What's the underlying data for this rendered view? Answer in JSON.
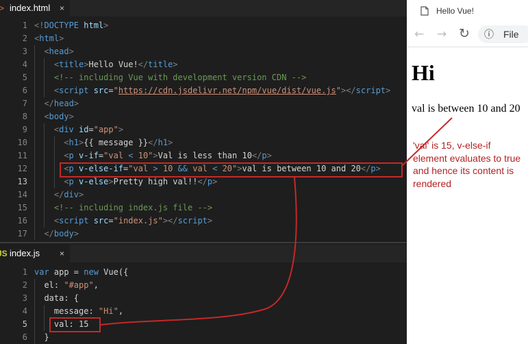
{
  "editor_top": {
    "tab": {
      "file_type": "<>",
      "name": "index.html",
      "close": "×"
    },
    "lines": [
      {
        "n": "1",
        "indent": 0,
        "tokens": [
          [
            "t-punc",
            "<!"
          ],
          [
            "t-tag",
            "DOCTYPE"
          ],
          [
            "t-txt",
            " "
          ],
          [
            "t-attr",
            "html"
          ],
          [
            "t-punc",
            ">"
          ]
        ]
      },
      {
        "n": "2",
        "indent": 0,
        "tokens": [
          [
            "t-punc",
            "<"
          ],
          [
            "t-tag",
            "html"
          ],
          [
            "t-punc",
            ">"
          ]
        ]
      },
      {
        "n": "3",
        "indent": 1,
        "tokens": [
          [
            "t-punc",
            "<"
          ],
          [
            "t-tag",
            "head"
          ],
          [
            "t-punc",
            ">"
          ]
        ]
      },
      {
        "n": "4",
        "indent": 2,
        "tokens": [
          [
            "t-punc",
            "<"
          ],
          [
            "t-tag",
            "title"
          ],
          [
            "t-punc",
            ">"
          ],
          [
            "t-txt",
            "Hello Vue!"
          ],
          [
            "t-punc",
            "</"
          ],
          [
            "t-tag",
            "title"
          ],
          [
            "t-punc",
            ">"
          ]
        ]
      },
      {
        "n": "5",
        "indent": 2,
        "tokens": [
          [
            "t-com",
            "<!-- including Vue with development version CDN -->"
          ]
        ]
      },
      {
        "n": "6",
        "indent": 2,
        "tokens": [
          [
            "t-punc",
            "<"
          ],
          [
            "t-tag",
            "script"
          ],
          [
            "t-txt",
            " "
          ],
          [
            "t-attr",
            "src"
          ],
          [
            "t-txt",
            "="
          ],
          [
            "t-str",
            "\""
          ],
          [
            "t-url",
            "https://cdn.jsdelivr.net/npm/vue/dist/vue.js"
          ],
          [
            "t-str",
            "\""
          ],
          [
            "t-punc",
            "></"
          ],
          [
            "t-tag",
            "script"
          ],
          [
            "t-punc",
            ">"
          ]
        ]
      },
      {
        "n": "7",
        "indent": 1,
        "tokens": [
          [
            "t-punc",
            "</"
          ],
          [
            "t-tag",
            "head"
          ],
          [
            "t-punc",
            ">"
          ]
        ]
      },
      {
        "n": "8",
        "indent": 1,
        "tokens": [
          [
            "t-punc",
            "<"
          ],
          [
            "t-tag",
            "body"
          ],
          [
            "t-punc",
            ">"
          ]
        ]
      },
      {
        "n": "9",
        "indent": 2,
        "tokens": [
          [
            "t-punc",
            "<"
          ],
          [
            "t-tag",
            "div"
          ],
          [
            "t-txt",
            " "
          ],
          [
            "t-attr",
            "id"
          ],
          [
            "t-txt",
            "="
          ],
          [
            "t-str",
            "\"app\""
          ],
          [
            "t-punc",
            ">"
          ]
        ]
      },
      {
        "n": "10",
        "indent": 3,
        "tokens": [
          [
            "t-punc",
            "<"
          ],
          [
            "t-tag",
            "h1"
          ],
          [
            "t-punc",
            ">"
          ],
          [
            "t-txt",
            "{{ message }}"
          ],
          [
            "t-punc",
            "</"
          ],
          [
            "t-tag",
            "h1"
          ],
          [
            "t-punc",
            ">"
          ]
        ]
      },
      {
        "n": "11",
        "indent": 3,
        "tokens": [
          [
            "t-punc",
            "<"
          ],
          [
            "t-tag",
            "p"
          ],
          [
            "t-txt",
            " "
          ],
          [
            "t-attr",
            "v-if"
          ],
          [
            "t-txt",
            "="
          ],
          [
            "t-str",
            "\"val "
          ],
          [
            "t-tag",
            "<"
          ],
          [
            "t-str",
            " 10\""
          ],
          [
            "t-punc",
            ">"
          ],
          [
            "t-txt",
            "Val is less than 10"
          ],
          [
            "t-punc",
            "</"
          ],
          [
            "t-tag",
            "p"
          ],
          [
            "t-punc",
            ">"
          ]
        ]
      },
      {
        "n": "12",
        "indent": 3,
        "tokens": [
          [
            "t-punc",
            "<"
          ],
          [
            "t-tag",
            "p"
          ],
          [
            "t-txt",
            " "
          ],
          [
            "t-attr",
            "v-else-if"
          ],
          [
            "t-txt",
            "="
          ],
          [
            "t-str",
            "\"val "
          ],
          [
            "t-tag",
            ">"
          ],
          [
            "t-str",
            " 10 "
          ],
          [
            "t-tag",
            "&&"
          ],
          [
            "t-str",
            " val "
          ],
          [
            "t-tag",
            "<"
          ],
          [
            "t-str",
            " 20\""
          ],
          [
            "t-punc",
            ">"
          ],
          [
            "t-txt",
            "val is between 10 and 20"
          ],
          [
            "t-punc",
            "</"
          ],
          [
            "t-tag",
            "p"
          ],
          [
            "t-punc",
            ">"
          ]
        ]
      },
      {
        "n": "13",
        "indent": 3,
        "tokens": [
          [
            "t-punc",
            "<"
          ],
          [
            "t-tag",
            "p"
          ],
          [
            "t-txt",
            " "
          ],
          [
            "t-attr",
            "v-else"
          ],
          [
            "t-punc",
            ">"
          ],
          [
            "t-txt",
            "Pretty high val!!"
          ],
          [
            "t-punc",
            "</"
          ],
          [
            "t-tag",
            "p"
          ],
          [
            "t-punc",
            ">"
          ]
        ]
      },
      {
        "n": "14",
        "indent": 2,
        "tokens": [
          [
            "t-punc",
            "</"
          ],
          [
            "t-tag",
            "div"
          ],
          [
            "t-punc",
            ">"
          ]
        ]
      },
      {
        "n": "15",
        "indent": 2,
        "tokens": [
          [
            "t-com",
            "<!-- including index.js file -->"
          ]
        ]
      },
      {
        "n": "16",
        "indent": 2,
        "tokens": [
          [
            "t-punc",
            "<"
          ],
          [
            "t-tag",
            "script"
          ],
          [
            "t-txt",
            " "
          ],
          [
            "t-attr",
            "src"
          ],
          [
            "t-txt",
            "="
          ],
          [
            "t-str",
            "\"index.js\""
          ],
          [
            "t-punc",
            "></"
          ],
          [
            "t-tag",
            "script"
          ],
          [
            "t-punc",
            ">"
          ]
        ]
      },
      {
        "n": "17",
        "indent": 1,
        "tokens": [
          [
            "t-punc",
            "</"
          ],
          [
            "t-tag",
            "body"
          ],
          [
            "t-punc",
            ">"
          ]
        ]
      }
    ],
    "active_line": "13"
  },
  "editor_bottom": {
    "tab": {
      "file_type": "JS",
      "name": "index.js",
      "close": "×"
    },
    "lines": [
      {
        "n": "1",
        "indent": 0,
        "tokens": [
          [
            "t-kw",
            "var"
          ],
          [
            "t-txt",
            " app = "
          ],
          [
            "t-kw",
            "new"
          ],
          [
            "t-txt",
            " Vue({"
          ]
        ]
      },
      {
        "n": "2",
        "indent": 1,
        "tokens": [
          [
            "t-txt",
            "el: "
          ],
          [
            "t-str",
            "\"#app\""
          ],
          [
            "t-txt",
            ","
          ]
        ]
      },
      {
        "n": "3",
        "indent": 1,
        "tokens": [
          [
            "t-txt",
            "data: {"
          ]
        ]
      },
      {
        "n": "4",
        "indent": 2,
        "tokens": [
          [
            "t-txt",
            "message: "
          ],
          [
            "t-str",
            "\"Hi\""
          ],
          [
            "t-txt",
            ","
          ]
        ]
      },
      {
        "n": "5",
        "indent": 2,
        "tokens": [
          [
            "t-txt",
            "val: 15"
          ]
        ]
      },
      {
        "n": "6",
        "indent": 1,
        "tokens": [
          [
            "t-txt",
            "}"
          ]
        ]
      }
    ],
    "active_line": "5"
  },
  "browser": {
    "tab_title": "Hello Vue!",
    "back": "←",
    "forward": "→",
    "reload": "↻",
    "info_icon": "ⓘ",
    "address": "File",
    "heading": "Hi",
    "paragraph": "val is between 10 and 20"
  },
  "annotation": {
    "text": "'val' is 15, v-else-if element evaluates to true and hence its content is rendered",
    "color": "#b22222"
  }
}
